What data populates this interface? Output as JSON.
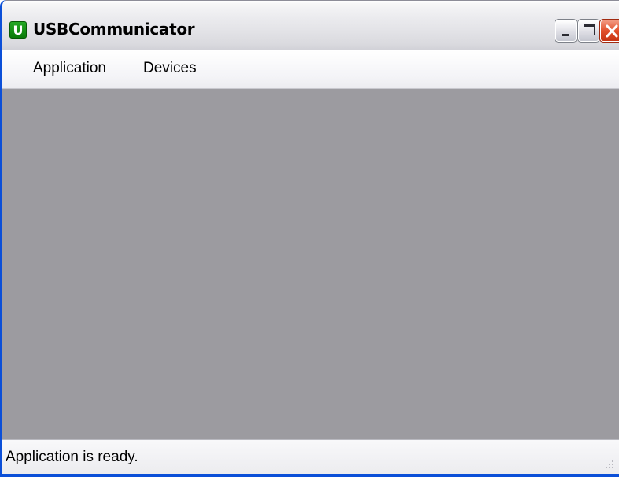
{
  "window": {
    "title": "USBCommunicator",
    "icon_letter": "U",
    "icon_name": "app-icon",
    "controls": [
      "minimize-icon",
      "maximize-icon",
      "close-icon"
    ]
  },
  "menu": {
    "items": [
      {
        "label": "Application"
      },
      {
        "label": "Devices"
      }
    ]
  },
  "status": {
    "text": "Application is ready."
  },
  "colors": {
    "client_bg": "#9c9ba0",
    "frame_accent": "#0b4fd8",
    "close_button": "#e2502c",
    "app_icon": "#1a9a1a"
  }
}
